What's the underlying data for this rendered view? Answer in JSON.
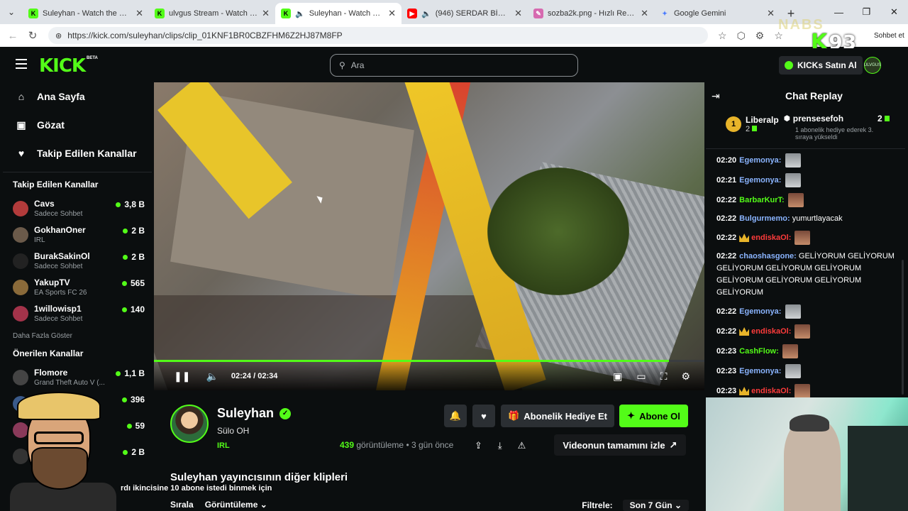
{
  "browser": {
    "tabs": [
      {
        "title": "Suleyhan - Watch the VOD on",
        "favicon": "kick",
        "active": false,
        "audio": false
      },
      {
        "title": "ulvgus Stream - Watch Live on",
        "favicon": "kick",
        "active": false,
        "audio": false
      },
      {
        "title": "Suleyhan - Watch clips on",
        "favicon": "kick",
        "active": true,
        "audio": true
      },
      {
        "title": "(946) SERDAR BİZ YABAN",
        "favicon": "youtube",
        "active": false,
        "audio": true
      },
      {
        "title": "sozba2k.png - Hızlı Resim",
        "favicon": "image",
        "active": false,
        "audio": false
      },
      {
        "title": "Google Gemini",
        "favicon": "gemini",
        "active": false,
        "audio": false
      }
    ],
    "url": "https://kick.com/suleyhan/clips/clip_01KNF1BR0CBZFHM6Z2HJ87M8FP",
    "overlay_sohbet": "Sohbet et"
  },
  "header": {
    "logo": "KICK",
    "beta": "BETA",
    "search_placeholder": "Ara",
    "kicks_button": "KICKs Satın Al",
    "user_badge": "ULVGUS"
  },
  "sidebar": {
    "nav": [
      {
        "label": "Ana Sayfa",
        "icon": "home-icon"
      },
      {
        "label": "Gözat",
        "icon": "browse-icon"
      },
      {
        "label": "Takip Edilen Kanallar",
        "icon": "heart-icon"
      }
    ],
    "following_title": "Takip Edilen Kanallar",
    "following": [
      {
        "name": "Cavs",
        "category": "Sadece Sohbet",
        "viewers": "3,8 B",
        "color": "#b23b3b"
      },
      {
        "name": "GokhanOner",
        "category": "IRL",
        "viewers": "2 B",
        "color": "#6b5a4a"
      },
      {
        "name": "BurakSakinOl",
        "category": "Sadece Sohbet",
        "viewers": "2 B",
        "color": "#222"
      },
      {
        "name": "YakupTV",
        "category": "EA Sports FC 26",
        "viewers": "565",
        "color": "#8a6a3a"
      },
      {
        "name": "1willowisp1",
        "category": "Sadece Sohbet",
        "viewers": "140",
        "color": "#a3334a"
      }
    ],
    "show_more": "Daha Fazla Göster",
    "recommended_title": "Önerilen Kanallar",
    "recommended": [
      {
        "name": "Flomore",
        "category": "Grand Theft Auto V (...",
        "viewers": "1,1 B",
        "color": "#444"
      },
      {
        "name": "",
        "category": "",
        "viewers": "396",
        "color": "#3a5a8a"
      },
      {
        "name": "",
        "category": "",
        "viewers": "59",
        "color": "#8a3a5a"
      },
      {
        "name": "B...",
        "category": "",
        "viewers": "2 B",
        "color": "#333"
      }
    ]
  },
  "video": {
    "current_time": "02:24",
    "separator": "/",
    "duration": "02:34",
    "progress_fraction": 0.935
  },
  "clip": {
    "streamer": "Suleyhan",
    "title": "Sülo OH",
    "category": "IRL",
    "views_count": "439",
    "views_label": "görüntüleme",
    "age": "• 3 gün önce",
    "gift_button": "Abonelik Hediye Et",
    "subscribe_button": "Abone Ol",
    "full_video_button": "Videonun tamamını izle",
    "others_title": "Suleyhan yayıncısının diğer klipleri",
    "sort_label": "Sırala",
    "sort_value": "Görüntüleme",
    "filter_label": "Filtrele:",
    "filter_value": "Son 7 Gün"
  },
  "overlay": {
    "caption": "rdı ikincisine 10 abone istedi binmek için",
    "brand_text": "NABS",
    "badge_k": "K",
    "badge_num": "93"
  },
  "chat": {
    "title": "Chat Replay",
    "pinned_gifter": {
      "rank": "1",
      "name": "Liberalp",
      "count": "2"
    },
    "pinned_sub": {
      "name": "prensesefoh",
      "count": "2",
      "desc": "1 abonelik hediye ederek 3. sıraya yükseldi"
    },
    "messages": [
      {
        "time": "02:20",
        "user": "Egemonya:",
        "color": "#8ab4ff",
        "text": "",
        "emote": "gray",
        "crown": false
      },
      {
        "time": "02:21",
        "user": "Egemonya:",
        "color": "#8ab4ff",
        "text": "",
        "emote": "gray",
        "crown": false
      },
      {
        "time": "02:22",
        "user": "BarbarKurT:",
        "color": "#53fc18",
        "text": "",
        "emote": "brown",
        "crown": false
      },
      {
        "time": "02:22",
        "user": "Bulgurmemo:",
        "color": "#8ab4ff",
        "text": "yumurtlayacak",
        "emote": "",
        "crown": false
      },
      {
        "time": "02:22",
        "user": "endiskaOl:",
        "color": "#ff3b3b",
        "text": "",
        "emote": "brown",
        "crown": true
      },
      {
        "time": "02:22",
        "user": "chaoshasgone:",
        "color": "#8ab4ff",
        "text": "GELİYORUM GELİYORUM GELİYORUM GELİYORUM GELİYORUM GELİYORUM GELİYORUM GELİYORUM GELİYORUM",
        "emote": "",
        "crown": false
      },
      {
        "time": "02:22",
        "user": "Egemonya:",
        "color": "#8ab4ff",
        "text": "",
        "emote": "gray",
        "crown": false
      },
      {
        "time": "02:22",
        "user": "endiskaOl:",
        "color": "#ff3b3b",
        "text": "",
        "emote": "brown",
        "crown": true
      },
      {
        "time": "02:23",
        "user": "CashFlow:",
        "color": "#53fc18",
        "text": "",
        "emote": "brown",
        "crown": false
      },
      {
        "time": "02:23",
        "user": "Egemonya:",
        "color": "#8ab4ff",
        "text": "",
        "emote": "gray",
        "crown": false
      },
      {
        "time": "02:23",
        "user": "endiskaOl:",
        "color": "#ff3b3b",
        "text": "",
        "emote": "brown",
        "crown": true
      }
    ]
  },
  "colors": {
    "brand": "#53fc18",
    "bg": "#0b0e0f",
    "button": "#2b2f33"
  }
}
